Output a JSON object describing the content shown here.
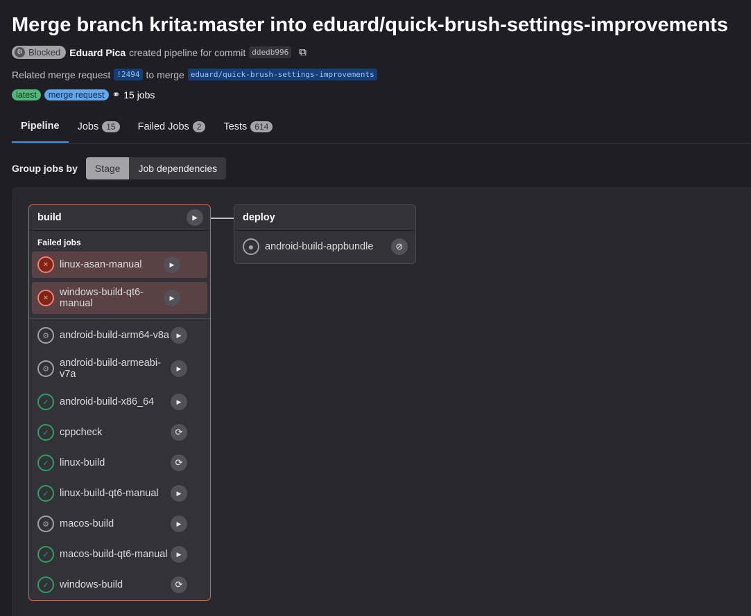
{
  "title": "Merge branch krita:master into eduard/quick-brush-settings-improvements",
  "status": "Blocked",
  "author": "Eduard Pica",
  "created_text": "created pipeline for commit",
  "commit": "ddedb996",
  "related_text": "Related merge request",
  "mr": "!2494",
  "to_merge": "to merge",
  "branch": "eduard/quick-brush-settings-improvements",
  "tags": [
    "latest",
    "merge request"
  ],
  "jobs_count": "15 jobs",
  "tabs": [
    {
      "label": "Pipeline"
    },
    {
      "label": "Jobs",
      "count": "15"
    },
    {
      "label": "Failed Jobs",
      "count": "2"
    },
    {
      "label": "Tests",
      "count": "614"
    }
  ],
  "group_label": "Group jobs by",
  "group_options": [
    "Stage",
    "Job dependencies"
  ],
  "stages": {
    "build": {
      "name": "build",
      "failed_label": "Failed jobs",
      "failed": [
        "linux-asan-manual",
        "windows-build-qt6-manual"
      ],
      "jobs": [
        {
          "name": "android-build-arm64-v8a",
          "status": "manual",
          "action": "play"
        },
        {
          "name": "android-build-armeabi-v7a",
          "status": "manual",
          "action": "play"
        },
        {
          "name": "android-build-x86_64",
          "status": "success",
          "action": "play"
        },
        {
          "name": "cppcheck",
          "status": "success",
          "action": "retry"
        },
        {
          "name": "linux-build",
          "status": "success",
          "action": "retry"
        },
        {
          "name": "linux-build-qt6-manual",
          "status": "success",
          "action": "play"
        },
        {
          "name": "macos-build",
          "status": "manual",
          "action": "play"
        },
        {
          "name": "macos-build-qt6-manual",
          "status": "success",
          "action": "play"
        },
        {
          "name": "windows-build",
          "status": "success",
          "action": "retry"
        }
      ]
    },
    "deploy": {
      "name": "deploy",
      "jobs": [
        {
          "name": "android-build-appbundle",
          "status": "skipped",
          "action": "cancel"
        }
      ]
    }
  }
}
